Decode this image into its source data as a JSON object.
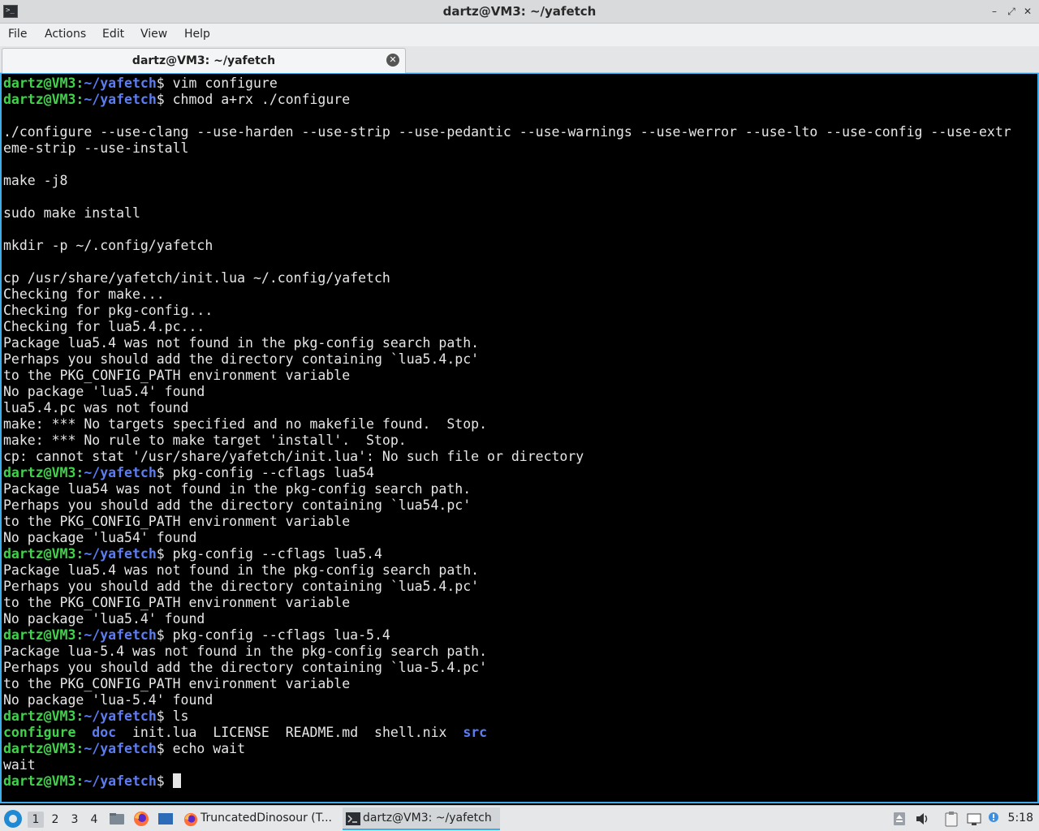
{
  "window": {
    "title": "dartz@VM3: ~/yafetch",
    "icon": "terminal-icon",
    "controls": [
      "minimize-icon",
      "maximize-icon",
      "close-icon"
    ]
  },
  "menu": [
    "File",
    "Actions",
    "Edit",
    "View",
    "Help"
  ],
  "tab": {
    "label": "dartz@VM3: ~/yafetch",
    "close_icon": "close-icon"
  },
  "terminal": {
    "prompt_user": "dartz@VM3:",
    "prompt_path": "~/yafetch",
    "prompt_sym": "$",
    "lines": [
      {
        "t": "prompt",
        "cmd": " vim configure"
      },
      {
        "t": "prompt",
        "cmd": " chmod a+rx ./configure"
      },
      {
        "t": "out",
        "text": ""
      },
      {
        "t": "out",
        "text": "./configure --use-clang --use-harden --use-strip --use-pedantic --use-warnings --use-werror --use-lto --use-config --use-extr"
      },
      {
        "t": "out",
        "text": "eme-strip --use-install"
      },
      {
        "t": "out",
        "text": ""
      },
      {
        "t": "out",
        "text": "make -j8"
      },
      {
        "t": "out",
        "text": ""
      },
      {
        "t": "out",
        "text": "sudo make install"
      },
      {
        "t": "out",
        "text": ""
      },
      {
        "t": "out",
        "text": "mkdir -p ~/.config/yafetch"
      },
      {
        "t": "out",
        "text": ""
      },
      {
        "t": "out",
        "text": "cp /usr/share/yafetch/init.lua ~/.config/yafetch"
      },
      {
        "t": "out",
        "text": "Checking for make..."
      },
      {
        "t": "out",
        "text": "Checking for pkg-config..."
      },
      {
        "t": "out",
        "text": "Checking for lua5.4.pc..."
      },
      {
        "t": "out",
        "text": "Package lua5.4 was not found in the pkg-config search path."
      },
      {
        "t": "out",
        "text": "Perhaps you should add the directory containing `lua5.4.pc'"
      },
      {
        "t": "out",
        "text": "to the PKG_CONFIG_PATH environment variable"
      },
      {
        "t": "out",
        "text": "No package 'lua5.4' found"
      },
      {
        "t": "out",
        "text": "lua5.4.pc was not found"
      },
      {
        "t": "out",
        "text": "make: *** No targets specified and no makefile found.  Stop."
      },
      {
        "t": "out",
        "text": "make: *** No rule to make target 'install'.  Stop."
      },
      {
        "t": "out",
        "text": "cp: cannot stat '/usr/share/yafetch/init.lua': No such file or directory"
      },
      {
        "t": "prompt",
        "cmd": " pkg-config --cflags lua54"
      },
      {
        "t": "out",
        "text": "Package lua54 was not found in the pkg-config search path."
      },
      {
        "t": "out",
        "text": "Perhaps you should add the directory containing `lua54.pc'"
      },
      {
        "t": "out",
        "text": "to the PKG_CONFIG_PATH environment variable"
      },
      {
        "t": "out",
        "text": "No package 'lua54' found"
      },
      {
        "t": "prompt",
        "cmd": " pkg-config --cflags lua5.4"
      },
      {
        "t": "out",
        "text": "Package lua5.4 was not found in the pkg-config search path."
      },
      {
        "t": "out",
        "text": "Perhaps you should add the directory containing `lua5.4.pc'"
      },
      {
        "t": "out",
        "text": "to the PKG_CONFIG_PATH environment variable"
      },
      {
        "t": "out",
        "text": "No package 'lua5.4' found"
      },
      {
        "t": "prompt",
        "cmd": " pkg-config --cflags lua-5.4"
      },
      {
        "t": "out",
        "text": "Package lua-5.4 was not found in the pkg-config search path."
      },
      {
        "t": "out",
        "text": "Perhaps you should add the directory containing `lua-5.4.pc'"
      },
      {
        "t": "out",
        "text": "to the PKG_CONFIG_PATH environment variable"
      },
      {
        "t": "out",
        "text": "No package 'lua-5.4' found"
      },
      {
        "t": "prompt",
        "cmd": " ls"
      },
      {
        "t": "ls",
        "items": [
          {
            "name": "configure",
            "kind": "exec"
          },
          {
            "name": "doc",
            "kind": "dir"
          },
          {
            "name": "init.lua",
            "kind": "file"
          },
          {
            "name": "LICENSE",
            "kind": "file"
          },
          {
            "name": "README.md",
            "kind": "file"
          },
          {
            "name": "shell.nix",
            "kind": "file"
          },
          {
            "name": "src",
            "kind": "dir"
          }
        ]
      },
      {
        "t": "prompt",
        "cmd": " echo wait"
      },
      {
        "t": "out",
        "text": "wait"
      },
      {
        "t": "prompt",
        "cmd": " ",
        "cursor": true
      }
    ]
  },
  "taskbar": {
    "start_icon": "app-menu-icon",
    "workspaces": [
      "1",
      "2",
      "3",
      "4"
    ],
    "active_workspace": "1",
    "launchers": [
      "file-manager-icon",
      "firefox-icon",
      "desktop-icon"
    ],
    "tasks": [
      {
        "label": "TruncatedDinosour (T...",
        "icon": "firefox-icon",
        "active": false
      },
      {
        "label": "dartz@VM3: ~/yafetch",
        "icon": "terminal-icon",
        "active": true
      }
    ],
    "tray_icons": [
      "disk-icon",
      "volume-icon",
      "clipboard-icon",
      "network-icon",
      "update-notification-icon"
    ],
    "clock": "5:18"
  },
  "colors": {
    "prompt_user": "#3fd34a",
    "prompt_path": "#5c7cf0",
    "terminal_bg": "#000000",
    "terminal_fg": "#e6e6e6",
    "accent": "#3daee9"
  }
}
